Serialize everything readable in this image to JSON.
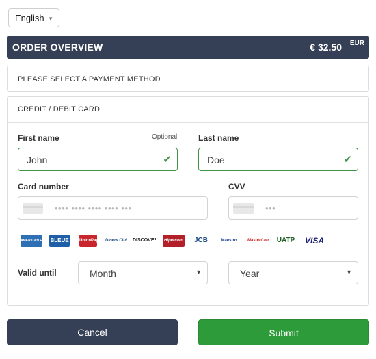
{
  "language": {
    "selected": "English"
  },
  "order": {
    "title": "ORDER OVERVIEW",
    "amount": "€ 32.50",
    "currency": "EUR"
  },
  "payment": {
    "select_prompt": "PLEASE SELECT A PAYMENT METHOD",
    "method_title": "CREDIT / DEBIT CARD"
  },
  "form": {
    "first_name": {
      "label": "First name",
      "optional": "Optional",
      "value": "John"
    },
    "last_name": {
      "label": "Last name",
      "value": "Doe"
    },
    "card_number": {
      "label": "Card number",
      "placeholder": "•••• •••• •••• •••• •••"
    },
    "cvv": {
      "label": "CVV",
      "placeholder": "•••"
    },
    "valid_until": {
      "label": "Valid until",
      "month": "Month",
      "year": "Year"
    }
  },
  "brands": [
    {
      "name": "AMERICAN EXPRESS",
      "bg": "#2f6fb3",
      "fg": "#ffffff"
    },
    {
      "name": "BLEUE",
      "bg": "#1e5fa8",
      "fg": "#ffffff"
    },
    {
      "name": "UnionPay",
      "bg": "#c8262c",
      "fg": "#ffffff"
    },
    {
      "name": "Diners Club",
      "bg": "#ffffff",
      "fg": "#1f4d86"
    },
    {
      "name": "DISCOVER",
      "bg": "#ffffff",
      "fg": "#222222"
    },
    {
      "name": "Hipercard",
      "bg": "#b3202a",
      "fg": "#ffffff"
    },
    {
      "name": "JCB",
      "bg": "#ffffff",
      "fg": "#1f4d86"
    },
    {
      "name": "Maestro",
      "bg": "#ffffff",
      "fg": "#1a3d8f"
    },
    {
      "name": "MasterCard",
      "bg": "#ffffff",
      "fg": "#cc2222"
    },
    {
      "name": "UATP",
      "bg": "#ffffff",
      "fg": "#1b5e20"
    },
    {
      "name": "VISA",
      "bg": "#ffffff",
      "fg": "#1a1f71"
    }
  ],
  "buttons": {
    "cancel": "Cancel",
    "submit": "Submit"
  },
  "colors": {
    "header": "#353f55",
    "valid": "#3f9246",
    "submit": "#2e9b3b"
  }
}
